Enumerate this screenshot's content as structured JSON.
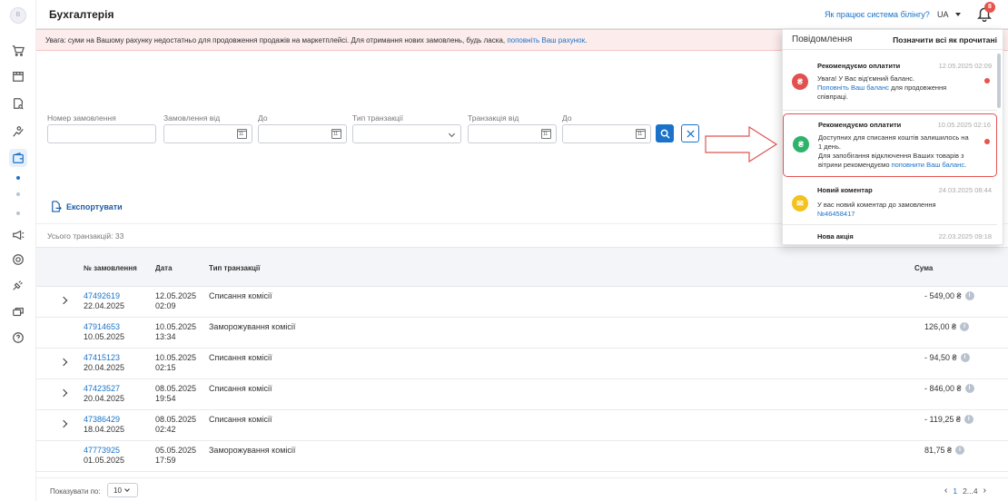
{
  "sidebar": {
    "logo_letter": "В",
    "items": [
      "cart-icon",
      "store-icon",
      "search-doc-icon",
      "analytics-icon",
      "wallet-icon",
      "megaphone-icon",
      "settings-icon",
      "plug-icon",
      "chat-icon",
      "help-icon"
    ],
    "active_item": "wallet-icon"
  },
  "header": {
    "title": "Бухгалтерія",
    "billing_link": "Як працює система білінгу?",
    "language": "UA",
    "notification_count": "8"
  },
  "warning": {
    "text": "Увага: суми на Вашому рахунку недостатньо для продовження продажів на маркетплейсі. Для отримання нових замовлень, будь ласка, ",
    "link": "поповніть Ваш рахунок",
    "suffix": "."
  },
  "filters": {
    "order_number_label": "Номер замовлення",
    "order_from_label": "Замовлення від",
    "order_to_label": "До",
    "transaction_type_label": "Тип транзакції",
    "transaction_from_label": "Транзакція від",
    "transaction_to_label": "До"
  },
  "export_label": "Експортувати",
  "total_transactions": "Усього транзакцій: 33",
  "table": {
    "headers": {
      "order": "№ замовлення",
      "date": "Дата",
      "type": "Тип транзакції",
      "sum": "Сума"
    },
    "rows": [
      {
        "order": "47492619",
        "order_date": "22.04.2025",
        "date": "12.05.2025",
        "time": "02:09",
        "type": "Списання комісії",
        "sum": "- 549,00 ₴",
        "expandable": true
      },
      {
        "order": "47914653",
        "order_date": "10.05.2025",
        "date": "10.05.2025",
        "time": "13:34",
        "type": "Заморожування комісії",
        "sum": "126,00 ₴",
        "expandable": false
      },
      {
        "order": "47415123",
        "order_date": "20.04.2025",
        "date": "10.05.2025",
        "time": "02:15",
        "type": "Списання комісії",
        "sum": "- 94,50 ₴",
        "expandable": true
      },
      {
        "order": "47423527",
        "order_date": "20.04.2025",
        "date": "08.05.2025",
        "time": "19:54",
        "type": "Списання комісії",
        "sum": "- 846,00 ₴",
        "expandable": true
      },
      {
        "order": "47386429",
        "order_date": "18.04.2025",
        "date": "08.05.2025",
        "time": "02:42",
        "type": "Списання комісії",
        "sum": "- 119,25 ₴",
        "expandable": true
      },
      {
        "order": "47773925",
        "order_date": "01.05.2025",
        "date": "05.05.2025",
        "time": "17:59",
        "type": "Заморожування комісії",
        "sum": "81,75 ₴",
        "expandable": false
      }
    ]
  },
  "footer": {
    "per_page_label": "Показувати по:",
    "per_page_value": "10",
    "pages": {
      "current": "1",
      "middle": "2...4"
    }
  },
  "notifications": {
    "title": "Повідомлення",
    "mark_all": "Позначити всі як прочитані",
    "items": [
      {
        "title": "Рекомендуємо оплатити",
        "time": "12.05.2025 02:09",
        "body_1": "Увага! У Вас від'ємний баланс.",
        "link": "Поповніть Ваш баланс",
        "body_2": " для продовження співпраці.",
        "color": "#e25050",
        "icon": "₴",
        "unread": true
      },
      {
        "title": "Рекомендуємо оплатити",
        "time": "10.05.2025 02:16",
        "body_1": "Доступних для списання коштів залишилось на 1 день.",
        "body_2": "Для запобігання відключення Ваших товарів з вітрини рекомендуємо ",
        "link": "поповнити Ваш баланс",
        "body_3": ".",
        "color": "#2db36a",
        "icon": "₴",
        "unread": true
      },
      {
        "title": "Новий коментар",
        "time": "24.03.2025 08:44",
        "body_1": "У вас новий коментар до замовлення",
        "link": "№46458417",
        "color": "#f3c21c",
        "icon": "✉",
        "unread": false
      },
      {
        "title": "Нова акція",
        "time": "22.03.2025 09:18"
      }
    ]
  }
}
